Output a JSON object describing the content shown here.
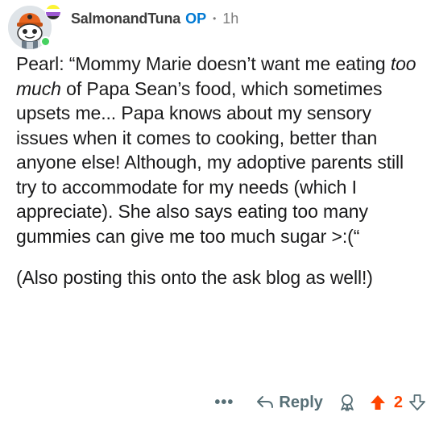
{
  "comment": {
    "username": "SalmonandTuna",
    "op_badge": "OP",
    "separator": "•",
    "timestamp": "1h",
    "paragraphs": [
      {
        "before": "Pearl: “Mommy Marie doesn’t want me eating ",
        "emphasis": "too much",
        "after": " of Papa Sean’s food, which sometimes upsets me... Papa knows about my sensory issues when it comes to cooking, better than anyone else! Although, my adoptive parents still try to accommodate for my needs (which I appreciate). She also says eating too many gummies can give me too much sugar >:(“"
      },
      {
        "text": "(Also posting this onto the ask blog as well!)"
      }
    ]
  },
  "actions": {
    "more_label": "•••",
    "reply_label": "Reply",
    "score": "2",
    "upvote_active": true
  },
  "colors": {
    "op": "#0079d3",
    "upvote": "#ff4500",
    "online": "#46d160",
    "muted": "#7c7c7c"
  },
  "icons": {
    "avatar": "reddit-snoo-avatar",
    "badge": "nonbinary-pride-badge",
    "reply": "reply-arrow-icon",
    "award": "award-icon",
    "upvote": "upvote-arrow-icon",
    "downvote": "downvote-arrow-icon"
  }
}
